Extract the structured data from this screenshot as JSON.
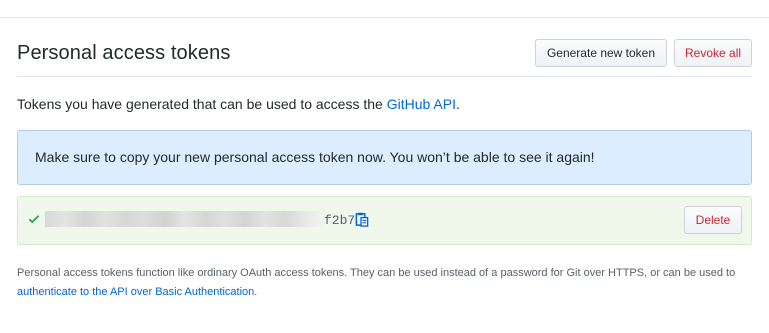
{
  "header": {
    "title": "Personal access tokens",
    "generate_label": "Generate new token",
    "revoke_label": "Revoke all"
  },
  "intro": {
    "text": "Tokens you have generated that can be used to access the ",
    "link_text": "GitHub API",
    "suffix": "."
  },
  "flash": {
    "message": "Make sure to copy your new personal access token now. You won’t be able to see it again!"
  },
  "token": {
    "visible_tail": "f2b7",
    "delete_label": "Delete"
  },
  "footnote": {
    "text": "Personal access tokens function like ordinary OAuth access tokens. They can be used instead of a password for Git over HTTPS, or can be used to ",
    "link_text": "authenticate to the API over Basic Authentication",
    "suffix": "."
  },
  "icons": {
    "check": "check-icon",
    "copy": "clipboard-icon"
  },
  "colors": {
    "link": "#0366d6",
    "danger": "#cb2431",
    "flash_bg": "#dbedff",
    "success_bg": "#f0f8ec",
    "check": "#28a745"
  }
}
